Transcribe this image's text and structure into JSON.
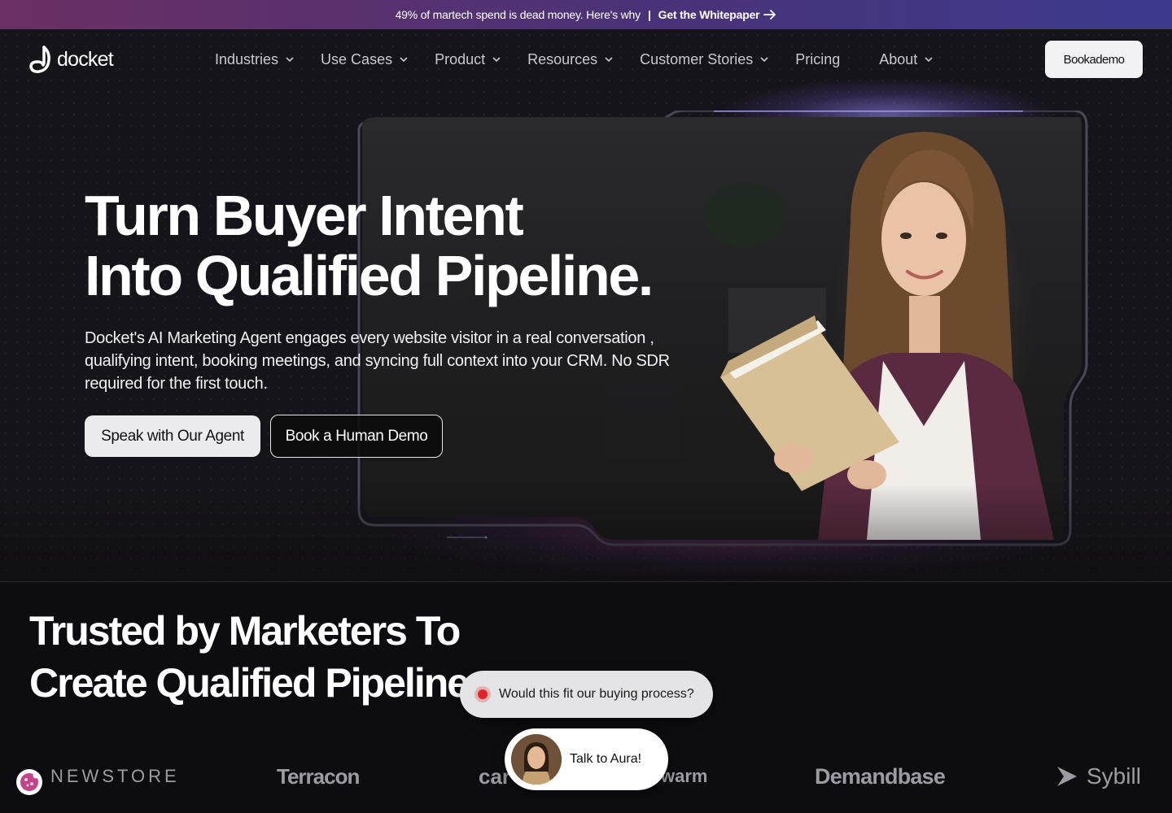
{
  "announcement": {
    "text": "49% of martech spend is dead money. Here's why",
    "separator": "|",
    "cta": "Get the Whitepaper"
  },
  "brand": {
    "name": "docket",
    "accent_top": "#6b2f63",
    "accent_bottom": "#3b3a8c"
  },
  "nav": {
    "items": [
      {
        "label": "Industries",
        "dropdown": true
      },
      {
        "label": "Use Cases",
        "dropdown": true
      },
      {
        "label": "Product",
        "dropdown": true
      },
      {
        "label": "Resources",
        "dropdown": true
      },
      {
        "label": "Customer Stories",
        "dropdown": true
      },
      {
        "label": "Pricing",
        "dropdown": false
      },
      {
        "label": "About",
        "dropdown": true
      }
    ],
    "cta": "Bookademo"
  },
  "hero": {
    "title_line1": "Turn Buyer Intent",
    "title_line2": "Into Qualified Pipeline.",
    "subtitle": "Docket's AI Marketing Agent engages every website visitor in a real conversation , qualifying intent, booking meetings, and syncing full context into your CRM. No SDR required for the first touch.",
    "primary_button": "Speak with Our Agent",
    "secondary_button": "Book a Human Demo"
  },
  "trusted": {
    "title_line1": "Trusted by Marketers To",
    "title_line2": "Create Qualified Pipeline"
  },
  "logos": [
    "NEWSTORE",
    "Terracon",
    "car",
    "warm",
    "Demandbase",
    "Sybill"
  ],
  "chat": {
    "question": "Would this fit our buying process?",
    "talk_label": "Talk to Aura!"
  }
}
